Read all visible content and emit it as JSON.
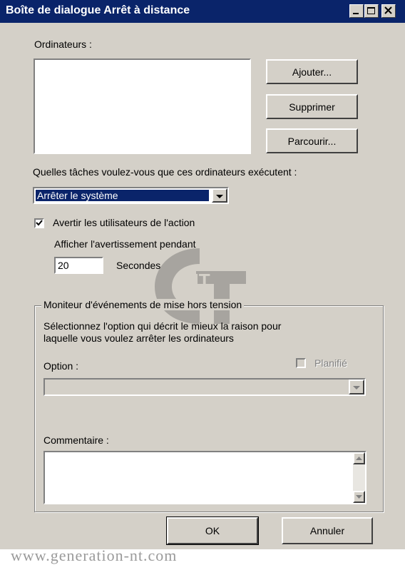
{
  "window": {
    "title": "Boîte de dialogue Arrêt à distance"
  },
  "computers": {
    "label": "Ordinateurs :",
    "add_button": "Ajouter...",
    "remove_button": "Supprimer",
    "browse_button": "Parcourir..."
  },
  "task": {
    "label": "Quelles tâches voulez-vous que ces ordinateurs exécutent :",
    "selected": "Arrêter le système"
  },
  "warn": {
    "checkbox_label": "Avertir les utilisateurs de l'action",
    "checked": true,
    "display_label": "Afficher l'avertissement pendant",
    "seconds_value": "20",
    "seconds_label": "Secondes"
  },
  "event_tracker": {
    "legend": "Moniteur d'événements de mise hors tension",
    "description_line1": "Sélectionnez l'option qui décrit le mieux la raison pour",
    "description_line2": "laquelle vous voulez arrêter les ordinateurs",
    "option_label": "Option :",
    "planned_label": "Planifié",
    "planned_checked": false,
    "comment_label": "Commentaire :"
  },
  "footer": {
    "ok_button": "OK",
    "cancel_button": "Annuler"
  },
  "watermark": {
    "text": "www.generation-nt.com",
    "logo_text": "NT"
  },
  "colors": {
    "titlebar": "#0a246a",
    "dialog_bg": "#d4d0c8",
    "selection": "#0a246a"
  }
}
